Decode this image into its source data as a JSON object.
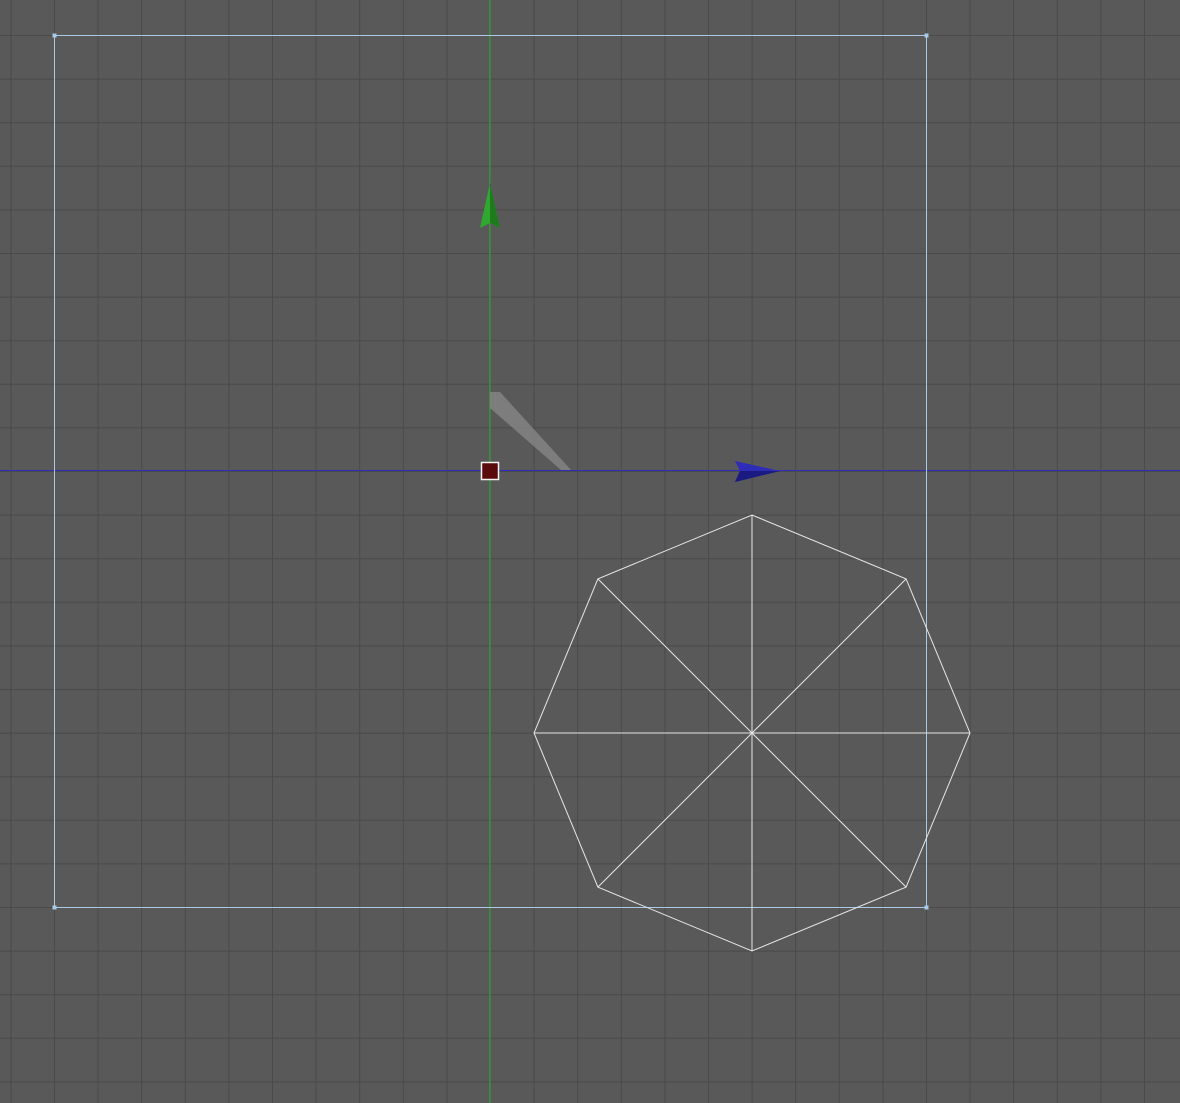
{
  "viewport": {
    "background": "#595959",
    "grid_color": "#4a4a4a",
    "view": "orthographic-2d"
  },
  "axes": {
    "vertical_axis_color": "#2fb82f",
    "horizontal_axis_color": "#2d2dbe"
  },
  "gizmo": {
    "type": "move",
    "up_arrow_color": "#2fa82f",
    "right_arrow_color": "#2d2db8",
    "center_handle_color": "#5a0a0a",
    "plane_handle_color": "#8a8a8a"
  },
  "selection_frame": {
    "color": "#a9c9e6"
  },
  "object": {
    "type": "octagon-wireframe",
    "edge_color": "#e6e6e6",
    "segments": 8
  }
}
